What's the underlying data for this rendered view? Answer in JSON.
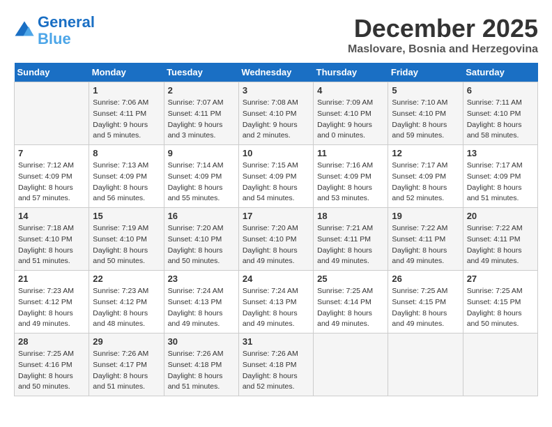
{
  "logo": {
    "line1": "General",
    "line2": "Blue"
  },
  "title": "December 2025",
  "subtitle": "Maslovare, Bosnia and Herzegovina",
  "days_of_week": [
    "Sunday",
    "Monday",
    "Tuesday",
    "Wednesday",
    "Thursday",
    "Friday",
    "Saturday"
  ],
  "weeks": [
    [
      {
        "day": "",
        "sunrise": "",
        "sunset": "",
        "daylight": ""
      },
      {
        "day": "1",
        "sunrise": "Sunrise: 7:06 AM",
        "sunset": "Sunset: 4:11 PM",
        "daylight": "Daylight: 9 hours and 5 minutes."
      },
      {
        "day": "2",
        "sunrise": "Sunrise: 7:07 AM",
        "sunset": "Sunset: 4:11 PM",
        "daylight": "Daylight: 9 hours and 3 minutes."
      },
      {
        "day": "3",
        "sunrise": "Sunrise: 7:08 AM",
        "sunset": "Sunset: 4:10 PM",
        "daylight": "Daylight: 9 hours and 2 minutes."
      },
      {
        "day": "4",
        "sunrise": "Sunrise: 7:09 AM",
        "sunset": "Sunset: 4:10 PM",
        "daylight": "Daylight: 9 hours and 0 minutes."
      },
      {
        "day": "5",
        "sunrise": "Sunrise: 7:10 AM",
        "sunset": "Sunset: 4:10 PM",
        "daylight": "Daylight: 8 hours and 59 minutes."
      },
      {
        "day": "6",
        "sunrise": "Sunrise: 7:11 AM",
        "sunset": "Sunset: 4:10 PM",
        "daylight": "Daylight: 8 hours and 58 minutes."
      }
    ],
    [
      {
        "day": "7",
        "sunrise": "Sunrise: 7:12 AM",
        "sunset": "Sunset: 4:09 PM",
        "daylight": "Daylight: 8 hours and 57 minutes."
      },
      {
        "day": "8",
        "sunrise": "Sunrise: 7:13 AM",
        "sunset": "Sunset: 4:09 PM",
        "daylight": "Daylight: 8 hours and 56 minutes."
      },
      {
        "day": "9",
        "sunrise": "Sunrise: 7:14 AM",
        "sunset": "Sunset: 4:09 PM",
        "daylight": "Daylight: 8 hours and 55 minutes."
      },
      {
        "day": "10",
        "sunrise": "Sunrise: 7:15 AM",
        "sunset": "Sunset: 4:09 PM",
        "daylight": "Daylight: 8 hours and 54 minutes."
      },
      {
        "day": "11",
        "sunrise": "Sunrise: 7:16 AM",
        "sunset": "Sunset: 4:09 PM",
        "daylight": "Daylight: 8 hours and 53 minutes."
      },
      {
        "day": "12",
        "sunrise": "Sunrise: 7:17 AM",
        "sunset": "Sunset: 4:09 PM",
        "daylight": "Daylight: 8 hours and 52 minutes."
      },
      {
        "day": "13",
        "sunrise": "Sunrise: 7:17 AM",
        "sunset": "Sunset: 4:09 PM",
        "daylight": "Daylight: 8 hours and 51 minutes."
      }
    ],
    [
      {
        "day": "14",
        "sunrise": "Sunrise: 7:18 AM",
        "sunset": "Sunset: 4:10 PM",
        "daylight": "Daylight: 8 hours and 51 minutes."
      },
      {
        "day": "15",
        "sunrise": "Sunrise: 7:19 AM",
        "sunset": "Sunset: 4:10 PM",
        "daylight": "Daylight: 8 hours and 50 minutes."
      },
      {
        "day": "16",
        "sunrise": "Sunrise: 7:20 AM",
        "sunset": "Sunset: 4:10 PM",
        "daylight": "Daylight: 8 hours and 50 minutes."
      },
      {
        "day": "17",
        "sunrise": "Sunrise: 7:20 AM",
        "sunset": "Sunset: 4:10 PM",
        "daylight": "Daylight: 8 hours and 49 minutes."
      },
      {
        "day": "18",
        "sunrise": "Sunrise: 7:21 AM",
        "sunset": "Sunset: 4:11 PM",
        "daylight": "Daylight: 8 hours and 49 minutes."
      },
      {
        "day": "19",
        "sunrise": "Sunrise: 7:22 AM",
        "sunset": "Sunset: 4:11 PM",
        "daylight": "Daylight: 8 hours and 49 minutes."
      },
      {
        "day": "20",
        "sunrise": "Sunrise: 7:22 AM",
        "sunset": "Sunset: 4:11 PM",
        "daylight": "Daylight: 8 hours and 49 minutes."
      }
    ],
    [
      {
        "day": "21",
        "sunrise": "Sunrise: 7:23 AM",
        "sunset": "Sunset: 4:12 PM",
        "daylight": "Daylight: 8 hours and 49 minutes."
      },
      {
        "day": "22",
        "sunrise": "Sunrise: 7:23 AM",
        "sunset": "Sunset: 4:12 PM",
        "daylight": "Daylight: 8 hours and 48 minutes."
      },
      {
        "day": "23",
        "sunrise": "Sunrise: 7:24 AM",
        "sunset": "Sunset: 4:13 PM",
        "daylight": "Daylight: 8 hours and 49 minutes."
      },
      {
        "day": "24",
        "sunrise": "Sunrise: 7:24 AM",
        "sunset": "Sunset: 4:13 PM",
        "daylight": "Daylight: 8 hours and 49 minutes."
      },
      {
        "day": "25",
        "sunrise": "Sunrise: 7:25 AM",
        "sunset": "Sunset: 4:14 PM",
        "daylight": "Daylight: 8 hours and 49 minutes."
      },
      {
        "day": "26",
        "sunrise": "Sunrise: 7:25 AM",
        "sunset": "Sunset: 4:15 PM",
        "daylight": "Daylight: 8 hours and 49 minutes."
      },
      {
        "day": "27",
        "sunrise": "Sunrise: 7:25 AM",
        "sunset": "Sunset: 4:15 PM",
        "daylight": "Daylight: 8 hours and 50 minutes."
      }
    ],
    [
      {
        "day": "28",
        "sunrise": "Sunrise: 7:25 AM",
        "sunset": "Sunset: 4:16 PM",
        "daylight": "Daylight: 8 hours and 50 minutes."
      },
      {
        "day": "29",
        "sunrise": "Sunrise: 7:26 AM",
        "sunset": "Sunset: 4:17 PM",
        "daylight": "Daylight: 8 hours and 51 minutes."
      },
      {
        "day": "30",
        "sunrise": "Sunrise: 7:26 AM",
        "sunset": "Sunset: 4:18 PM",
        "daylight": "Daylight: 8 hours and 51 minutes."
      },
      {
        "day": "31",
        "sunrise": "Sunrise: 7:26 AM",
        "sunset": "Sunset: 4:18 PM",
        "daylight": "Daylight: 8 hours and 52 minutes."
      },
      {
        "day": "",
        "sunrise": "",
        "sunset": "",
        "daylight": ""
      },
      {
        "day": "",
        "sunrise": "",
        "sunset": "",
        "daylight": ""
      },
      {
        "day": "",
        "sunrise": "",
        "sunset": "",
        "daylight": ""
      }
    ]
  ]
}
